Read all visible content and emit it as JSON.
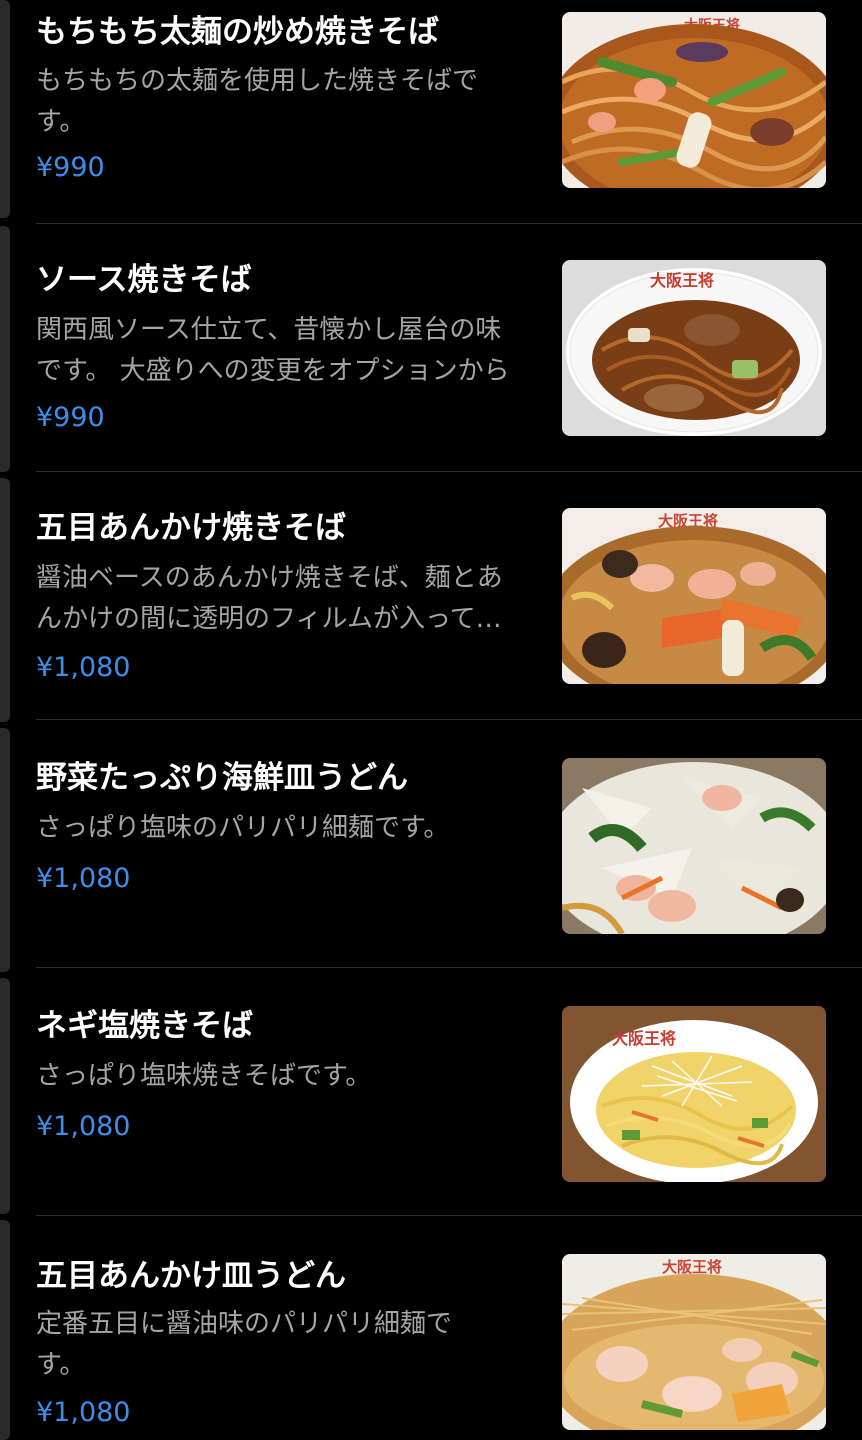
{
  "menu": {
    "items": [
      {
        "title": "もちもち太麺の炒め焼きそば",
        "description": "もちもちの太麺を使用した焼きそばです。",
        "price": "¥990",
        "image": "thick-noodle-yakisoba-photo"
      },
      {
        "title": "ソース焼きそば",
        "description": "関西風ソース仕立て、昔懐かし屋台の味です。 大盛りへの変更をオプションから",
        "price": "¥990",
        "image": "sauce-yakisoba-photo"
      },
      {
        "title": "五目あんかけ焼きそば",
        "description": "醤油ベースのあんかけ焼きそば、麺とあんかけの間に透明のフィルムが入っています",
        "price": "¥1,080",
        "image": "gomoku-ankake-yakisoba-photo"
      },
      {
        "title": "野菜たっぷり海鮮皿うどん",
        "description": "さっぱり塩味のパリパリ細麺です。",
        "price": "¥1,080",
        "image": "seafood-sara-udon-photo"
      },
      {
        "title": "ネギ塩焼きそば",
        "description": "さっぱり塩味焼きそばです。",
        "price": "¥1,080",
        "image": "negi-shio-yakisoba-photo"
      },
      {
        "title": "五目あんかけ皿うどん",
        "description": "定番五目に醤油味のパリパリ細麺です。",
        "price": "¥1,080",
        "image": "gomoku-ankake-sara-udon-photo"
      }
    ]
  },
  "theme": {
    "background": "#000000",
    "title_color": "#ffffff",
    "description_color": "#a5a5a5",
    "price_color": "#3d8ee8",
    "divider_color": "#2b2b2b"
  }
}
